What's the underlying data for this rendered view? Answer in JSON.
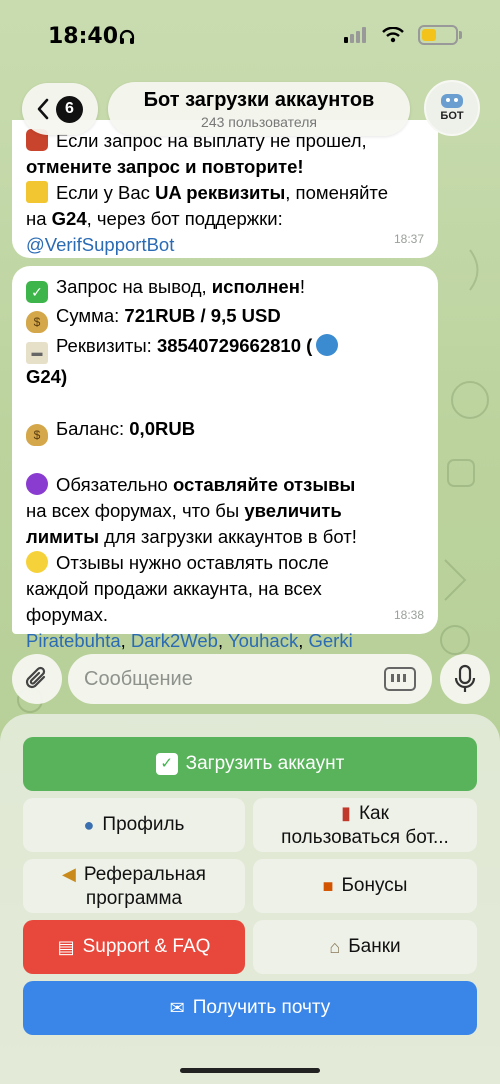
{
  "status": {
    "time": "18:40"
  },
  "header": {
    "back_count": "6",
    "title": "Бот загрузки аккаунтов",
    "subtitle": "243 пользователя",
    "avatar_label": "БОТ"
  },
  "messages": [
    {
      "lines": [
        [
          "Если запрос на выплату не прошел,"
        ],
        [
          "отмените запрос и повторите!"
        ],
        [
          "Если у Вас ",
          "UA реквизиты",
          ", поменяйте"
        ],
        [
          "на ",
          "G24",
          ", через бот поддержки:"
        ],
        [
          "@VerifSupportBot"
        ]
      ],
      "time": "18:37"
    },
    {
      "line1": [
        "Запрос на вывод, ",
        "исполнен",
        "!"
      ],
      "line2": [
        "Сумма: ",
        "721RUB  / 9,5 USD"
      ],
      "line3": [
        "Реквизиты: ",
        "38540729662810 ("
      ],
      "line4": [
        "G24)"
      ],
      "line5": [
        "Баланс: ",
        "0,0RUB"
      ],
      "line6": [
        "Обязательно ",
        "оставляйте отзывы"
      ],
      "line7": [
        "на всех форумах, что бы ",
        "увеличить"
      ],
      "line8": [
        "лимиты",
        " для загрузки аккаунтов в бот!"
      ],
      "line9": [
        "Отзывы нужно оставлять после"
      ],
      "line10": [
        "каждой продажи аккаунта, на всех"
      ],
      "line11": [
        "форумах."
      ],
      "links": [
        "Piratebuhta",
        "Dark2Web",
        "Youhack",
        "Gerki"
      ],
      "time": "18:38"
    }
  ],
  "input": {
    "placeholder": "Сообщение"
  },
  "keyboard": {
    "upload": "Загрузить аккаунт",
    "profile": "Профиль",
    "howto_line1": "Как",
    "howto_line2": "пользоваться бот...",
    "referral_line1": "Реферальная",
    "referral_line2": "программа",
    "bonuses": "Бонусы",
    "support": "Support & FAQ",
    "banks": "Банки",
    "mail": "Получить почту"
  },
  "colors": {
    "green_button": "#58b35b",
    "red_button": "#e8483c",
    "blue_button": "#3a86e8",
    "link": "#2a6bb4"
  }
}
